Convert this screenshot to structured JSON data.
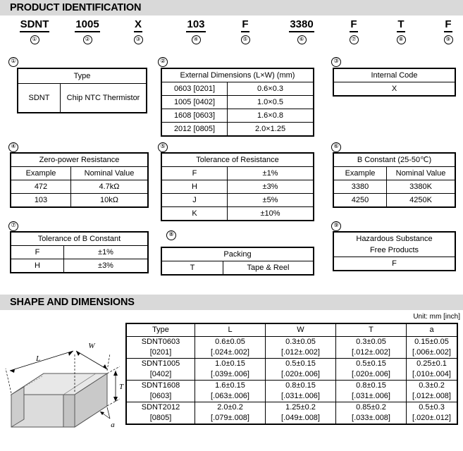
{
  "sections": {
    "product_identification": "PRODUCT IDENTIFICATION",
    "shape_and_dimensions": "SHAPE AND DIMENSIONS"
  },
  "part_number": {
    "segments": [
      {
        "value": "SDNT",
        "index": "①"
      },
      {
        "value": "1005",
        "index": "②"
      },
      {
        "value": "X",
        "index": "③"
      },
      {
        "value": "103",
        "index": "④"
      },
      {
        "value": "F",
        "index": "⑤"
      },
      {
        "value": "3380",
        "index": "⑥"
      },
      {
        "value": "F",
        "index": "⑦"
      },
      {
        "value": "T",
        "index": "⑧"
      },
      {
        "value": "F",
        "index": "⑨"
      }
    ]
  },
  "tables": {
    "type": {
      "marker": "①",
      "header": "Type",
      "rows": [
        [
          "SDNT",
          "Chip NTC Thermistor"
        ]
      ]
    },
    "external_dimensions": {
      "marker": "②",
      "header": "External Dimensions (L×W) (mm)",
      "rows": [
        [
          "0603 [0201]",
          "0.6×0.3"
        ],
        [
          "1005 [0402]",
          "1.0×0.5"
        ],
        [
          "1608 [0603]",
          "1.6×0.8"
        ],
        [
          "2012 [0805]",
          "2.0×1.25"
        ]
      ]
    },
    "internal_code": {
      "marker": "③",
      "header": "Internal Code",
      "rows": [
        [
          "X"
        ]
      ]
    },
    "zero_power_resistance": {
      "marker": "④",
      "header": "Zero-power Resistance",
      "columns": [
        "Example",
        "Nominal Value"
      ],
      "rows": [
        [
          "472",
          "4.7kΩ"
        ],
        [
          "103",
          "10kΩ"
        ]
      ]
    },
    "tolerance_of_resistance": {
      "marker": "⑤",
      "header": "Tolerance of Resistance",
      "rows": [
        [
          "F",
          "±1%"
        ],
        [
          "H",
          "±3%"
        ],
        [
          "J",
          "±5%"
        ],
        [
          "K",
          "±10%"
        ]
      ]
    },
    "b_constant": {
      "marker": "⑥",
      "header": "B Constant (25-50℃)",
      "columns": [
        "Example",
        "Nominal Value"
      ],
      "rows": [
        [
          "3380",
          "3380K"
        ],
        [
          "4250",
          "4250K"
        ]
      ]
    },
    "tolerance_of_b_constant": {
      "marker": "⑦",
      "header": "Tolerance of B Constant",
      "rows": [
        [
          "F",
          "±1%"
        ],
        [
          "H",
          "±3%"
        ]
      ]
    },
    "packing": {
      "marker": "⑧",
      "header": "Packing",
      "rows": [
        [
          "T",
          "Tape & Reel"
        ]
      ]
    },
    "hazardous_substance": {
      "marker": "⑨",
      "header_line1": "Hazardous Substance",
      "header_line2": "Free Products",
      "rows": [
        [
          "F"
        ]
      ]
    }
  },
  "dimensions": {
    "unit_note": "Unit: mm [inch]",
    "columns": [
      "Type",
      "L",
      "W",
      "T",
      "a"
    ],
    "rows": [
      {
        "type_mm": "SDNT0603",
        "type_in": "[0201]",
        "L_mm": "0.6±0.05",
        "L_in": "[.024±.002]",
        "W_mm": "0.3±0.05",
        "W_in": "[.012±.002]",
        "T_mm": "0.3±0.05",
        "T_in": "[.012±.002]",
        "a_mm": "0.15±0.05",
        "a_in": "[.006±.002]"
      },
      {
        "type_mm": "SDNT1005",
        "type_in": "[0402]",
        "L_mm": "1.0±0.15",
        "L_in": "[.039±.006]",
        "W_mm": "0.5±0.15",
        "W_in": "[.020±.006]",
        "T_mm": "0.5±0.15",
        "T_in": "[.020±.006]",
        "a_mm": "0.25±0.1",
        "a_in": "[.010±.004]"
      },
      {
        "type_mm": "SDNT1608",
        "type_in": "[0603]",
        "L_mm": "1.6±0.15",
        "L_in": "[.063±.006]",
        "W_mm": "0.8±0.15",
        "W_in": "[.031±.006]",
        "T_mm": "0.8±0.15",
        "T_in": "[.031±.006]",
        "a_mm": "0.3±0.2",
        "a_in": "[.012±.008]"
      },
      {
        "type_mm": "SDNT2012",
        "type_in": "[0805]",
        "L_mm": "2.0±0.2",
        "L_in": "[.079±.008]",
        "W_mm": "1.25±0.2",
        "W_in": "[.049±.008]",
        "T_mm": "0.85±0.2",
        "T_in": "[.033±.008]",
        "a_mm": "0.5±0.3",
        "a_in": "[.020±.012]"
      }
    ],
    "drawing_labels": {
      "L": "L",
      "W": "W",
      "T": "T",
      "a": "a"
    }
  }
}
